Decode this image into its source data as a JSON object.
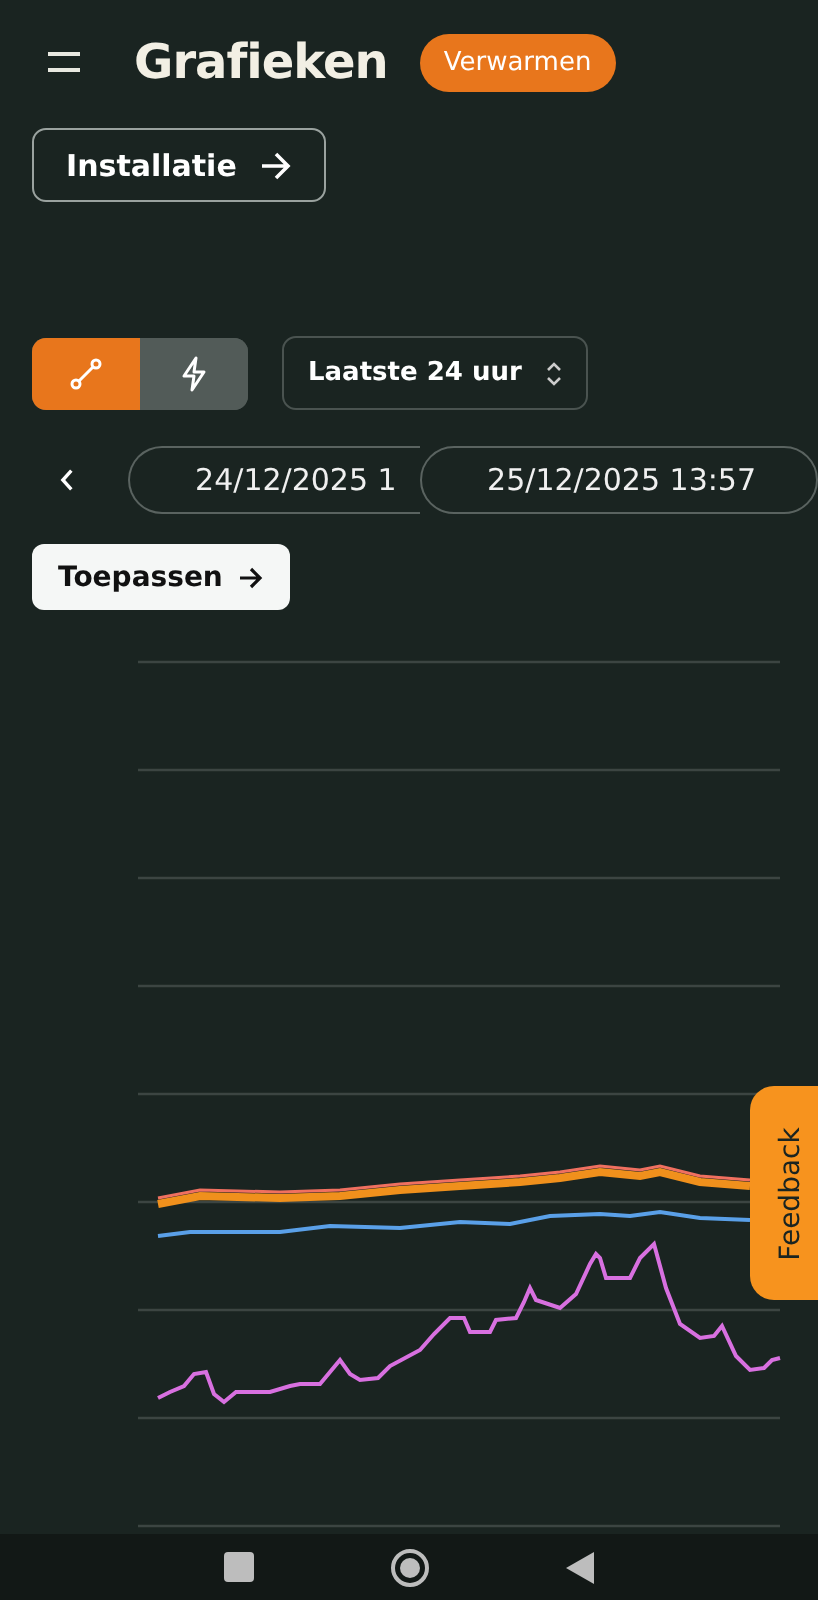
{
  "header": {
    "title": "Grafieken",
    "mode_badge": "Verwarmen"
  },
  "installation_button": {
    "label": "Installatie"
  },
  "view_toggle": [
    {
      "kind": "line",
      "selected": true
    },
    {
      "kind": "power",
      "selected": false
    }
  ],
  "range_select": {
    "value": "Laatste 24 uur"
  },
  "date_range": {
    "start": "24/12/2025 1",
    "end": "25/12/2025 13:57"
  },
  "apply_button": {
    "label": "Toepassen"
  },
  "feedback_tab": {
    "label": "Feedback"
  }
}
